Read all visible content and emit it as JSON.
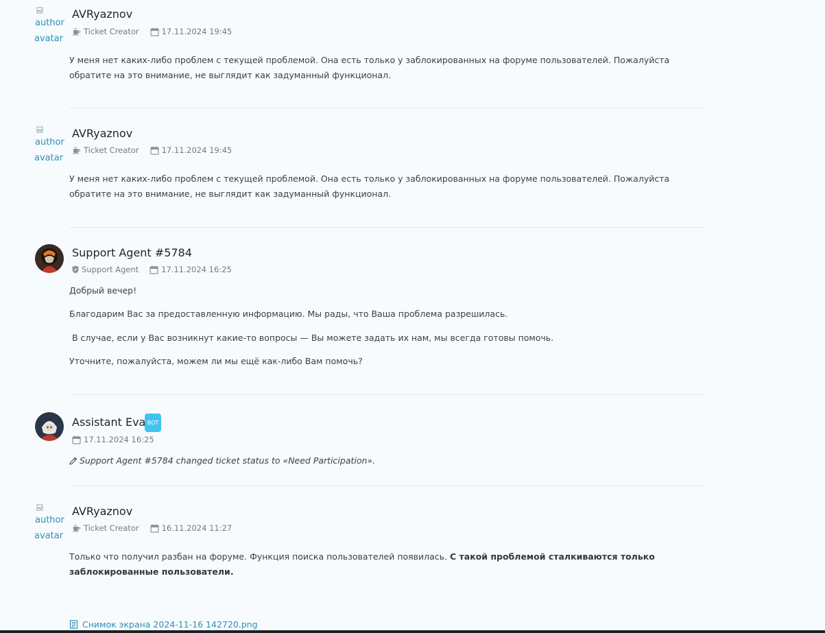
{
  "posts": [
    {
      "author": "AVRyaznov",
      "avatar_alt": [
        "author",
        "avatar"
      ],
      "role": "Ticket Creator",
      "date": "17.11.2024 19:45",
      "text": "У меня нет каких-либо проблем с текущей проблемой. Она есть только у заблокированных на форуме пользователей. Пожалуйста обратите на это внимание, не выглядит как задуманный функционал."
    },
    {
      "author": "AVRyaznov",
      "avatar_alt": [
        "author",
        "avatar"
      ],
      "role": "Ticket Creator",
      "date": "17.11.2024 19:45",
      "text": "У меня нет каких-либо проблем с текущей проблемой. Она есть только у заблокированных на форуме пользователей. Пожалуйста обратите на это внимание, не выглядит как задуманный функционал."
    },
    {
      "author": "Support Agent #5784",
      "role": "Support Agent",
      "date": "17.11.2024 16:25",
      "paragraphs": [
        "Добрый вечер!",
        "Благодарим Вас за предоставленную информацию. Мы рады, что Ваша проблема разрешилась.",
        " В случае, если у Вас возникнут какие-то вопросы — Вы можете задать их нам, мы всегда готовы помочь.",
        "Уточните, пожалуйста, можем ли мы ещё как-либо Вам помочь?"
      ]
    },
    {
      "author": "Assistant Eva",
      "badge": "BOT",
      "date": "17.11.2024 16:25",
      "status_text": "Support Agent #5784 changed ticket status to «Need Participation»."
    },
    {
      "author": "AVRyaznov",
      "avatar_alt": [
        "author",
        "avatar"
      ],
      "role": "Ticket Creator",
      "date": "16.11.2024 11:27",
      "text_plain": "Только что получил разбан на форуме. Функция поиска пользователей появилась. ",
      "text_bold": "С такой проблемой сталкиваются только заблокированные пользователи.",
      "attachment": "Снимок экрана 2024-11-16 142720.png"
    }
  ],
  "icons": {
    "role_creator": "coffee-cup-icon",
    "role_agent": "shield-icon",
    "date": "calendar-icon",
    "status": "pencil-icon",
    "attachment": "document-icon"
  },
  "colors": {
    "link": "#2b8fb8",
    "bot_badge": "#3fc3f0",
    "meta": "#727a81"
  }
}
